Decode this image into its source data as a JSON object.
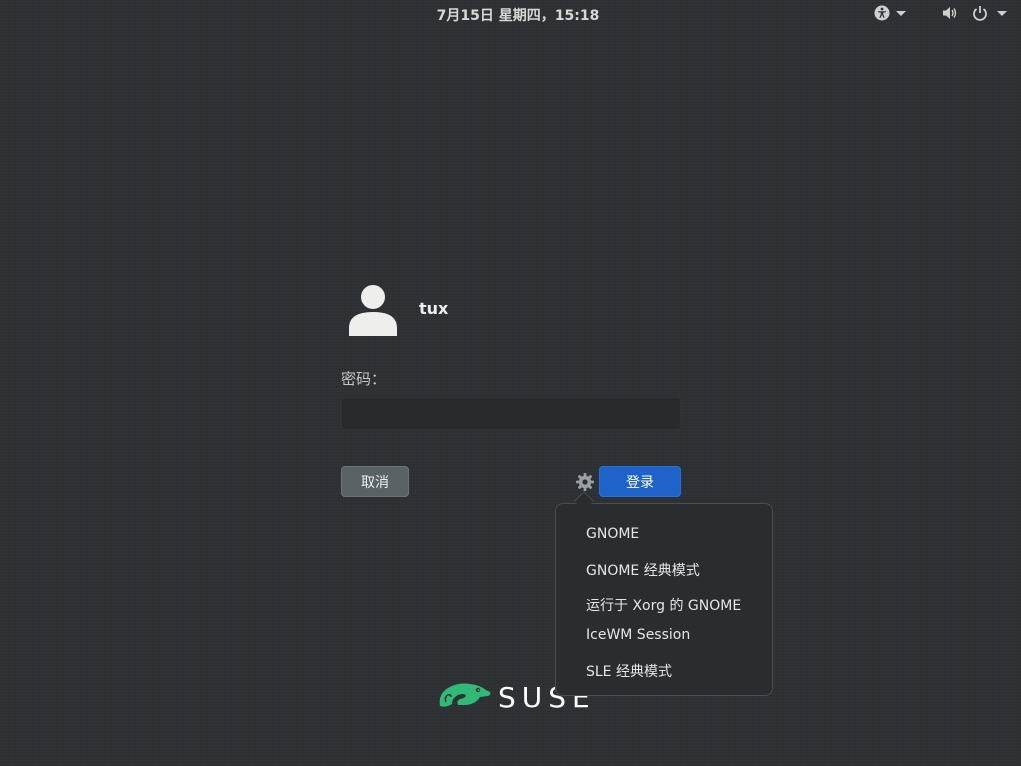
{
  "topbar": {
    "clock": "7月15日 星期四，15:18",
    "icons": [
      "accessibility-icon",
      "volume-icon",
      "power-icon"
    ]
  },
  "login": {
    "username": "tux",
    "password_label": "密码：",
    "password_value": "",
    "cancel_label": "取消",
    "login_label": "登录"
  },
  "session_menu": {
    "items": [
      "GNOME",
      "GNOME 经典模式",
      "运行于 Xorg 的 GNOME",
      "IceWM Session",
      "SLE 经典模式"
    ]
  },
  "branding": {
    "logo_text": "SUSE",
    "brand_color": "#30ba78"
  },
  "colors": {
    "background": "#2c3033",
    "accent": "#1f62c9"
  }
}
